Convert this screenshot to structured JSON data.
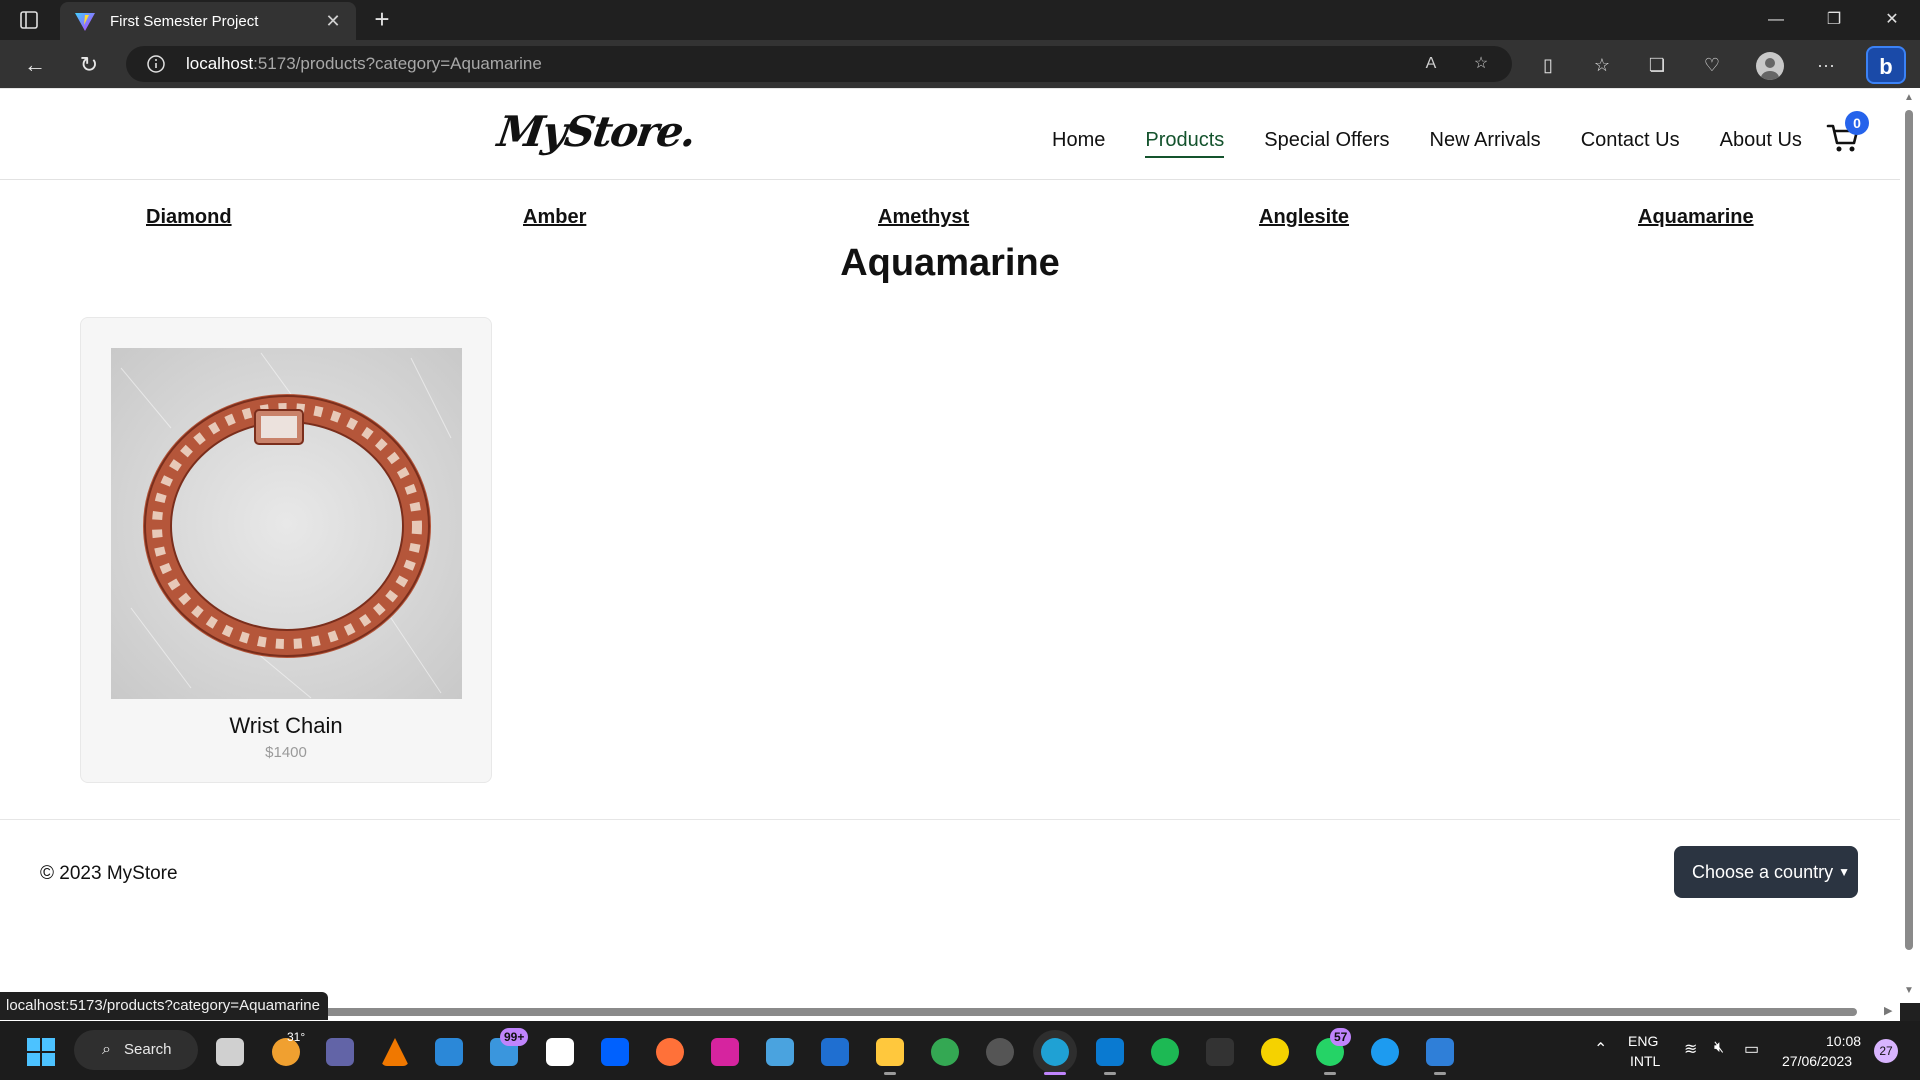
{
  "browser": {
    "tab_title": "First Semester Project",
    "new_tab_symbol": "+",
    "url_host": "localhost",
    "url_rest": ":5173/products?category=Aquamarine",
    "status_url": "localhost:5173/products?category=Aquamarine"
  },
  "site": {
    "logo": "MyStore.",
    "nav": {
      "home": "Home",
      "products": "Products",
      "special_offers": "Special Offers",
      "new_arrivals": "New Arrivals",
      "contact_us": "Contact Us",
      "about_us": "About Us"
    },
    "active_nav": "Products",
    "cart_count": "0",
    "accent_color": "#14532d",
    "badge_color": "#2563eb"
  },
  "categories": [
    "Diamond",
    "Amber",
    "Amethyst",
    "Anglesite",
    "Aquamarine"
  ],
  "page_title": "Aquamarine",
  "products": [
    {
      "name": "Wrist Chain",
      "price": "$1400",
      "image_icon": "rose-gold-cuban-chain-bracelet"
    }
  ],
  "footer": {
    "copyright": "© 2023 MyStore",
    "country_select": "Choose a country"
  },
  "taskbar": {
    "search_label": "Search",
    "weather_temp": "31°",
    "mail_badge": "99+",
    "whatsapp_badge": "57",
    "lang_top": "ENG",
    "lang_bottom": "INTL",
    "time": "10:08",
    "date": "27/06/2023",
    "notification_count": "27"
  }
}
